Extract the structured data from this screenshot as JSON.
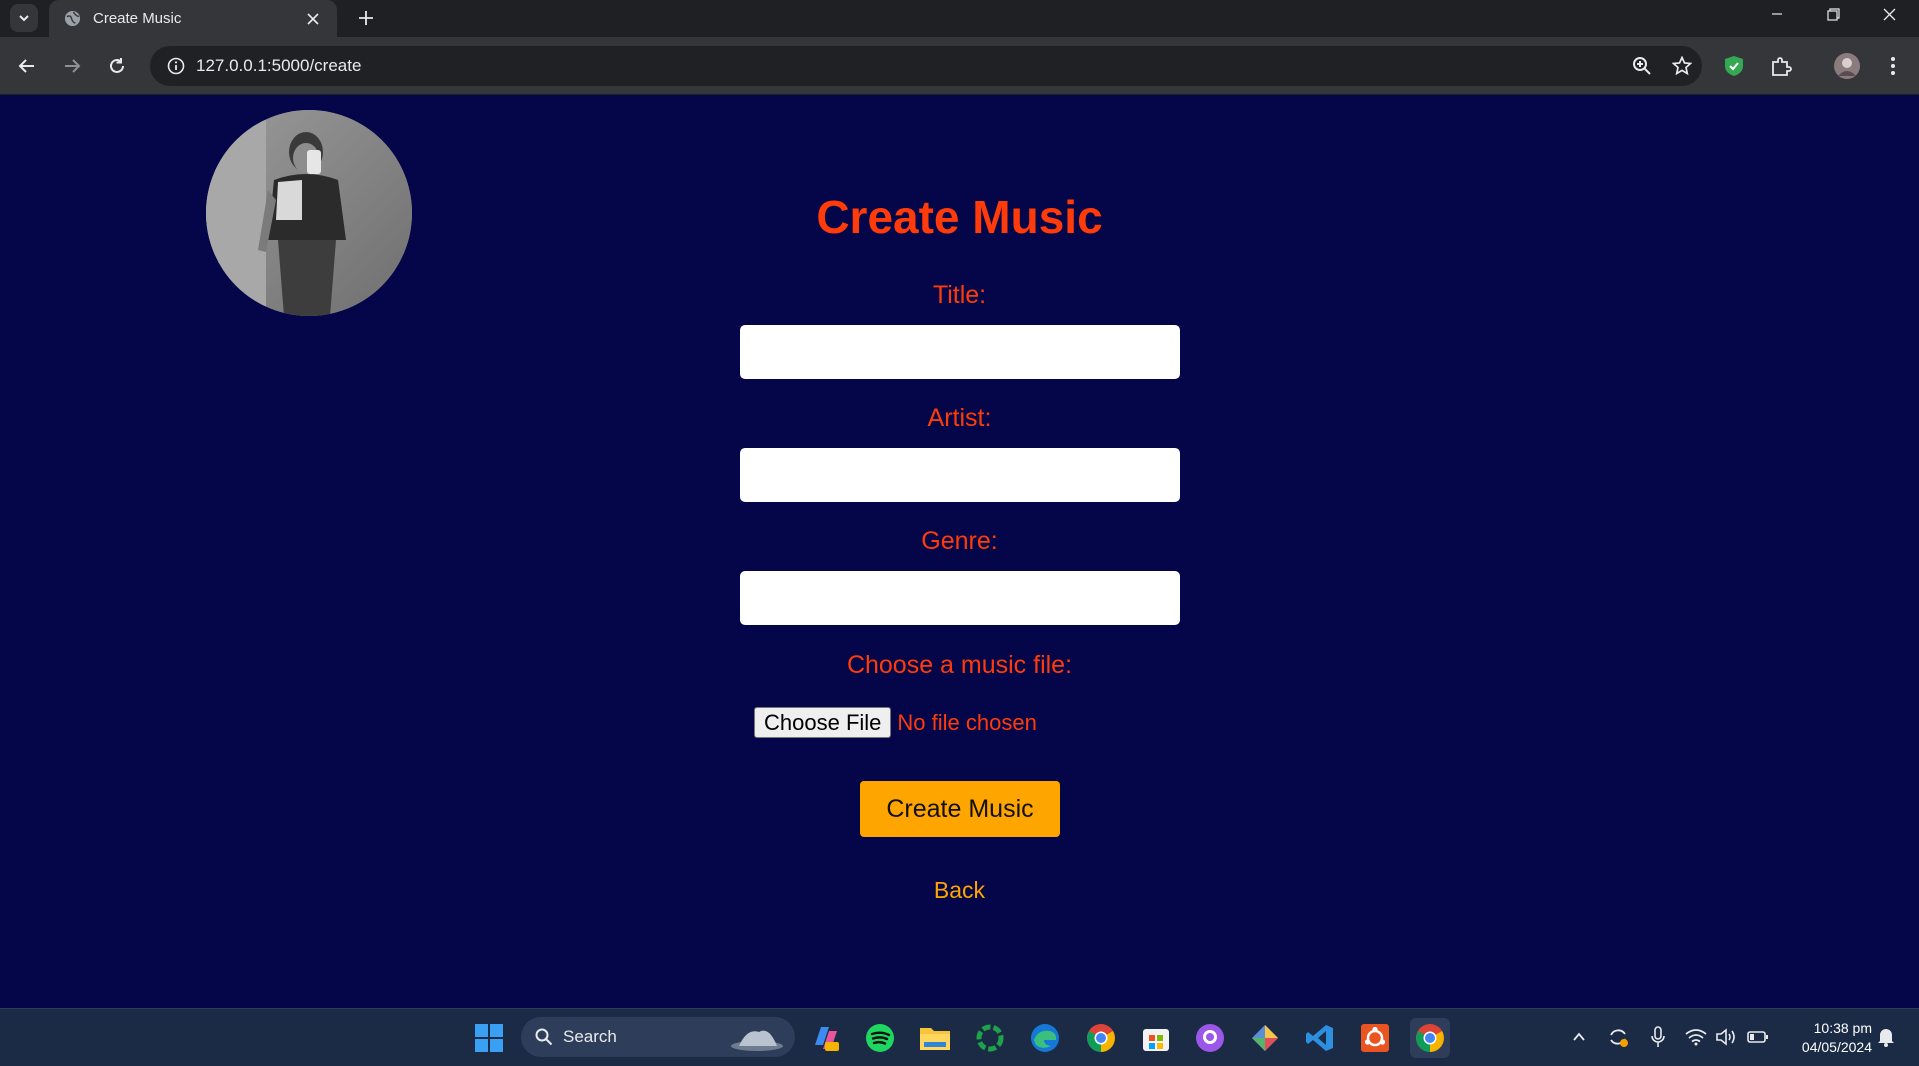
{
  "browser": {
    "tab_title": "Create Music",
    "url": "127.0.0.1:5000/create"
  },
  "page": {
    "title": "Create Music",
    "fields": {
      "title_label": "Title:",
      "artist_label": "Artist:",
      "genre_label": "Genre:",
      "file_label": "Choose a music file:"
    },
    "file_input": {
      "button_label": "Choose File",
      "status": "No file chosen"
    },
    "submit_label": "Create Music",
    "back_label": "Back"
  },
  "taskbar": {
    "search_label": "Search",
    "clock_time": "10:38 pm",
    "clock_date": "04/05/2024"
  },
  "colors": {
    "page_background": "#050549",
    "heading_color": "#ff3b0a",
    "button_accent": "#ffa500"
  }
}
